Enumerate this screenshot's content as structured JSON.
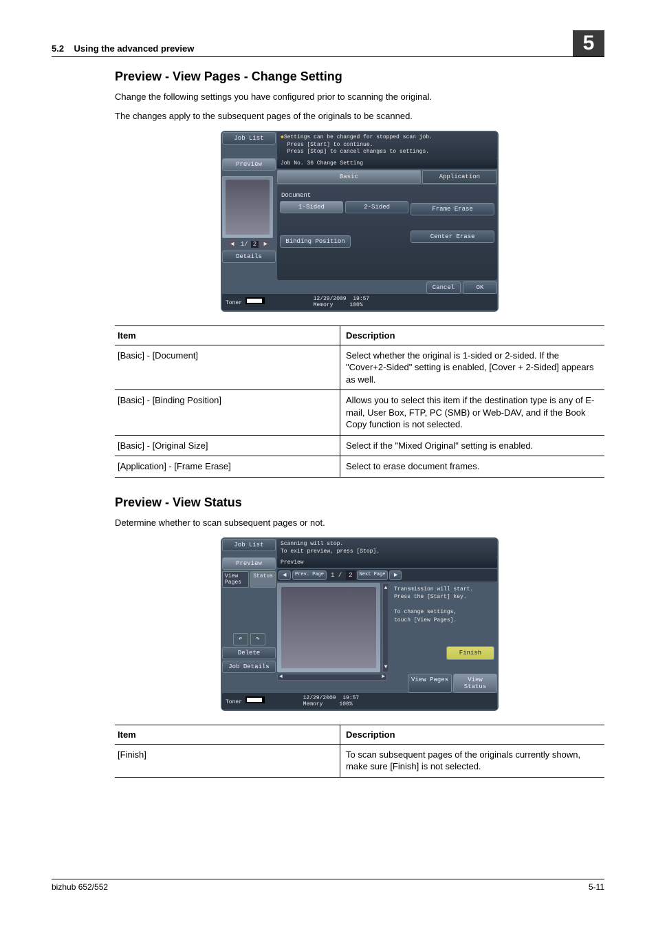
{
  "header": {
    "section_num": "5.2",
    "section_title": "Using the advanced preview",
    "chapter_num": "5"
  },
  "sect1": {
    "title": "Preview - View Pages - Change Setting",
    "p1": "Change the following settings you have configured prior to scanning the original.",
    "p2": "The changes apply to the subsequent pages of the originals to be scanned."
  },
  "ss1": {
    "job_list": "Job List",
    "note_l1": "Settings can be changed for stopped scan job.",
    "note_l2": "Press [Start] to continue.",
    "note_l3": "Press [Stop] to cancel changes to settings.",
    "preview": "Preview",
    "bar": "Job No.    36  Change Setting",
    "tab_basic": "Basic",
    "tab_app": "Application",
    "document": "Document",
    "one_sided": "1-Sided",
    "two_sided": "2-Sided",
    "frame_erase": "Frame Erase",
    "binding": "Binding Position",
    "center_erase": "Center Erase",
    "pager_cur": "1/",
    "pager_tot": "2",
    "details": "Details",
    "toner": "Toner",
    "date": "12/29/2009",
    "time": "19:57",
    "memory": "Memory",
    "mem_pct": "100%",
    "cancel": "Cancel",
    "ok": "OK"
  },
  "table1": {
    "h_item": "Item",
    "h_desc": "Description",
    "rows": [
      {
        "item": "[Basic] - [Document]",
        "desc": "Select whether the original is 1-sided or 2-sided. If the \"Cover+2-Sided\" setting is enabled, [Cover + 2-Sided] appears as well."
      },
      {
        "item": "[Basic] - [Binding Position]",
        "desc": "Allows you to select this item if the destination type is any of E-mail, User Box, FTP, PC (SMB) or Web-DAV, and if the Book Copy function is not selected."
      },
      {
        "item": "[Basic] - [Original Size]",
        "desc": "Select if the \"Mixed Original\" setting is enabled."
      },
      {
        "item": "[Application] - [Frame Erase]",
        "desc": "Select to erase document frames."
      }
    ]
  },
  "sect2": {
    "title": "Preview - View Status",
    "p1": "Determine whether to scan subsequent pages or not."
  },
  "ss2": {
    "job_list": "Job List",
    "note_l1": "Scanning will stop.",
    "note_l2": "To exit preview, press [Stop].",
    "preview_btn": "Preview",
    "preview_label": "Preview",
    "view_pages_tab": "View Pages",
    "status_tab": "Status",
    "prev_page": "Prev. Page",
    "next_page": "Next Page",
    "pager_cur": "1 /",
    "pager_tot": "2",
    "info_l1": "Transmission will start.",
    "info_l2": "Press the [Start] key.",
    "info_l3": "To change settings,",
    "info_l4": "touch [View Pages].",
    "finish": "Finish",
    "delete": "Delete",
    "job_details": "Job Details",
    "view_pages": "View Pages",
    "view_status": "View Status",
    "toner": "Toner",
    "date": "12/29/2009",
    "time": "19:57",
    "memory": "Memory",
    "mem_pct": "100%"
  },
  "table2": {
    "h_item": "Item",
    "h_desc": "Description",
    "rows": [
      {
        "item": "[Finish]",
        "desc": "To scan subsequent pages of the originals currently shown, make sure [Finish] is not selected."
      }
    ]
  },
  "footer": {
    "model": "bizhub 652/552",
    "pageno": "5-11"
  }
}
